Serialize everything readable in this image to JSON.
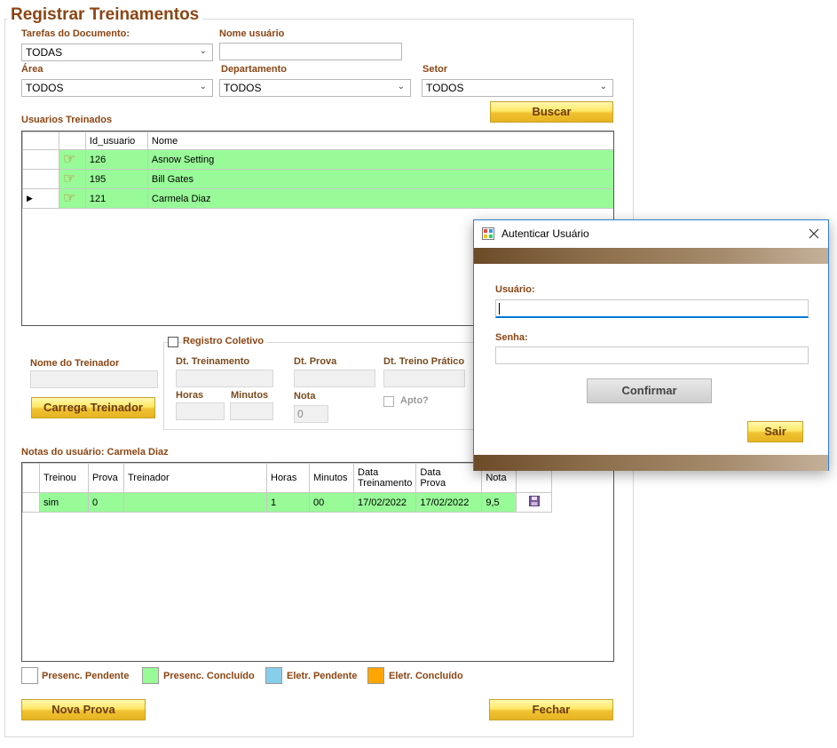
{
  "form": {
    "title": "Registrar Treinamentos",
    "filters": {
      "tarefas_label": "Tarefas do Documento:",
      "tarefas_value": "TODAS",
      "nome_usuario_label": "Nome usuário",
      "nome_usuario_value": "",
      "area_label": "Área",
      "area_value": "TODOS",
      "departamento_label": "Departamento",
      "departamento_value": "TODOS",
      "setor_label": "Setor",
      "setor_value": "TODOS",
      "buscar_label": "Buscar"
    },
    "usuarios": {
      "label": "Usuarios Treinados",
      "columns": [
        "Id_usuario",
        "Nome"
      ],
      "rows": [
        {
          "id": "126",
          "nome": "Asnow Setting"
        },
        {
          "id": "195",
          "nome": "Bill Gates"
        },
        {
          "id": "121",
          "nome": "Carmela Diaz"
        }
      ],
      "current_row_marker": "▶",
      "hand_icon": "pointing-hand-icon"
    },
    "treinador": {
      "label": "Nome do Treinador",
      "value": "",
      "button_label": "Carrega Treinador"
    },
    "registro_coletivo": {
      "checkbox_label": "Registro Coletivo",
      "dt_treinamento_label": "Dt. Treinamento",
      "dt_prova_label": "Dt. Prova",
      "dt_treino_pratico_label": "Dt. Treino Prático",
      "horas_label": "Horas",
      "minutos_label": "Minutos",
      "nota_label": "Nota",
      "nota_value": "0",
      "apto_label": "Apto?"
    },
    "notas": {
      "label": "Notas do usuário: Carmela Diaz",
      "columns": [
        "Treinou",
        "Prova",
        "Treinador",
        "Horas",
        "Minutos",
        "Data\nTreinamento",
        "Data\nProva",
        "Nota"
      ],
      "column_lines": [
        [
          "Treinou"
        ],
        [
          "Prova"
        ],
        [
          "Treinador"
        ],
        [
          "Horas"
        ],
        [
          "Minutos"
        ],
        [
          "Data",
          "Treinamento"
        ],
        [
          "Data",
          "Prova"
        ],
        [
          "Nota"
        ]
      ],
      "rows": [
        {
          "treinou": "sim",
          "prova": "0",
          "treinador": "",
          "horas": "1",
          "minutos": "00",
          "data_treinamento": "17/02/2022",
          "data_prova": "17/02/2022",
          "nota": "9,5",
          "save_icon": "floppy-disk-icon"
        }
      ]
    },
    "legend": [
      {
        "label": "Presenc. Pendente",
        "color": "#ffffff"
      },
      {
        "label": "Presenc. Concluído",
        "color": "#98fb98"
      },
      {
        "label": "Eletr. Pendente",
        "color": "#87ceeb"
      },
      {
        "label": "Eletr. Concluído",
        "color": "#ffa500"
      }
    ],
    "nova_prova_label": "Nova Prova",
    "fechar_label": "Fechar"
  },
  "dialog": {
    "title": "Autenticar Usuário",
    "app_icon": "app-window-icon",
    "close_icon": "close-icon",
    "usuario_label": "Usuário:",
    "usuario_value": "",
    "senha_label": "Senha:",
    "senha_value": "",
    "confirmar_label": "Confirmar",
    "sair_label": "Sair"
  },
  "colors": {
    "label_brown": "#8b4513",
    "row_green": "#98fb98",
    "button_yellow": "#ffe866",
    "dialog_border": "#2f7fd6"
  }
}
